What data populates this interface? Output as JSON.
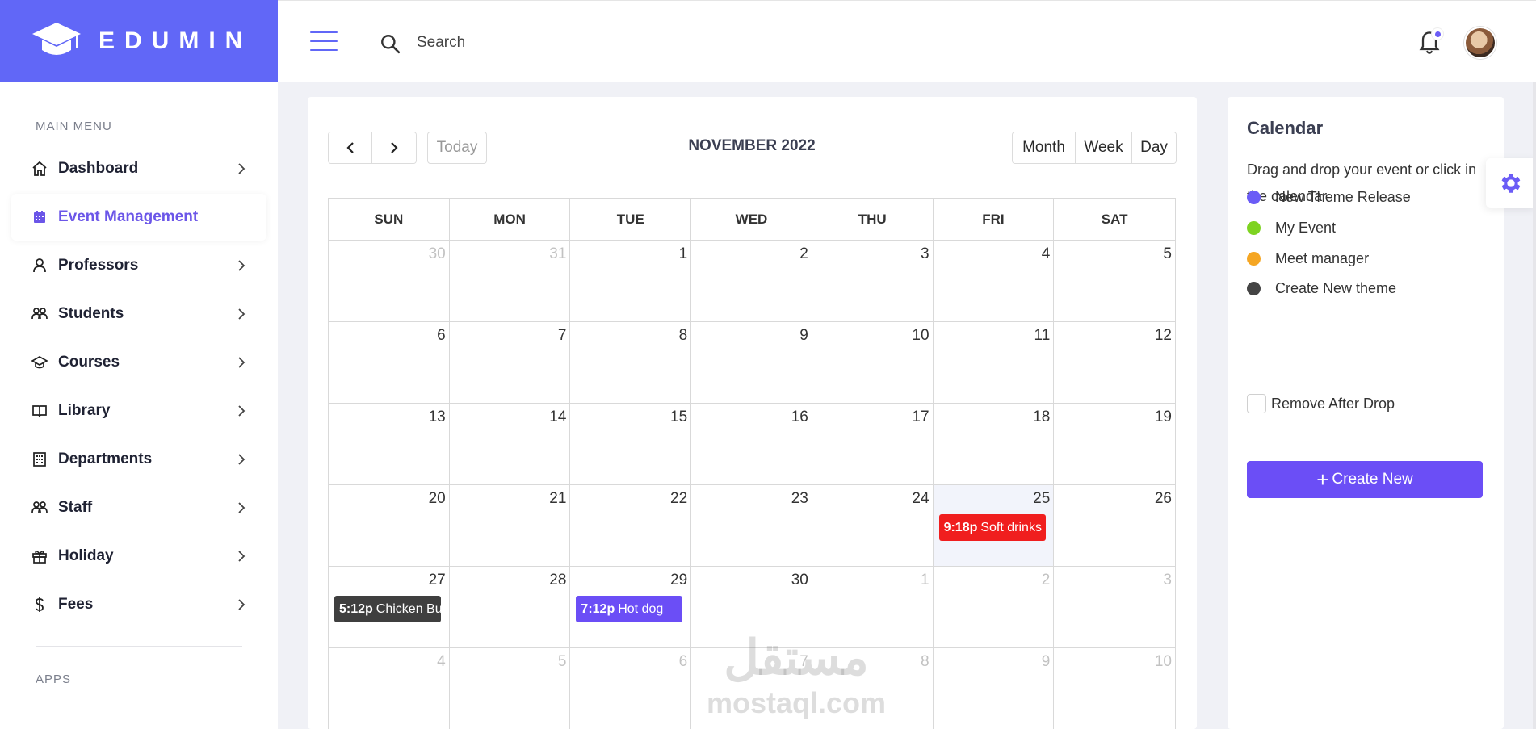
{
  "brand": {
    "name": "EDUMIN",
    "color": "#6167f7"
  },
  "header": {
    "search_placeholder": "Search"
  },
  "sidebar": {
    "section_main": "MAIN MENU",
    "section_apps": "APPS",
    "items": [
      {
        "label": "Dashboard",
        "icon": "home-icon"
      },
      {
        "label": "Event Management",
        "icon": "calendar-icon",
        "active": true
      },
      {
        "label": "Professors",
        "icon": "user-icon"
      },
      {
        "label": "Students",
        "icon": "users-icon"
      },
      {
        "label": "Courses",
        "icon": "graduation-cap-icon"
      },
      {
        "label": "Library",
        "icon": "book-icon"
      },
      {
        "label": "Departments",
        "icon": "building-icon"
      },
      {
        "label": "Staff",
        "icon": "users-icon"
      },
      {
        "label": "Holiday",
        "icon": "gift-icon"
      },
      {
        "label": "Fees",
        "icon": "dollar-icon"
      }
    ]
  },
  "calendar": {
    "title": "NOVEMBER 2022",
    "today_label": "Today",
    "views": [
      "Month",
      "Week",
      "Day"
    ],
    "weekdays": [
      "SUN",
      "MON",
      "TUE",
      "WED",
      "THU",
      "FRI",
      "SAT"
    ],
    "days": [
      {
        "n": "30",
        "other": true
      },
      {
        "n": "31",
        "other": true
      },
      {
        "n": "1"
      },
      {
        "n": "2"
      },
      {
        "n": "3"
      },
      {
        "n": "4"
      },
      {
        "n": "5"
      },
      {
        "n": "6"
      },
      {
        "n": "7"
      },
      {
        "n": "8"
      },
      {
        "n": "9"
      },
      {
        "n": "10"
      },
      {
        "n": "11"
      },
      {
        "n": "12"
      },
      {
        "n": "13"
      },
      {
        "n": "14"
      },
      {
        "n": "15"
      },
      {
        "n": "16"
      },
      {
        "n": "17"
      },
      {
        "n": "18"
      },
      {
        "n": "19"
      },
      {
        "n": "20"
      },
      {
        "n": "21"
      },
      {
        "n": "22"
      },
      {
        "n": "23"
      },
      {
        "n": "24"
      },
      {
        "n": "25",
        "today": true
      },
      {
        "n": "26"
      },
      {
        "n": "27"
      },
      {
        "n": "28"
      },
      {
        "n": "29"
      },
      {
        "n": "30"
      },
      {
        "n": "1",
        "other": true
      },
      {
        "n": "2",
        "other": true
      },
      {
        "n": "3",
        "other": true
      },
      {
        "n": "4",
        "other": true
      },
      {
        "n": "5",
        "other": true
      },
      {
        "n": "6",
        "other": true
      },
      {
        "n": "7",
        "other": true
      },
      {
        "n": "8",
        "other": true
      },
      {
        "n": "9",
        "other": true
      },
      {
        "n": "10",
        "other": true
      }
    ],
    "events": [
      {
        "day_index": 26,
        "time": "9:18p",
        "title": "Soft drinks",
        "color": "#f01e1e"
      },
      {
        "day_index": 28,
        "time": "5:12p",
        "title": "Chicken Burger",
        "color": "#3f3f3f"
      },
      {
        "day_index": 30,
        "time": "7:12p",
        "title": "Hot dog",
        "color": "#6b4ef6"
      }
    ]
  },
  "panel": {
    "title": "Calendar",
    "description": "Drag and drop your event or click in the calendar",
    "legend": [
      {
        "label": "New Theme Release",
        "color": "#6b5cf6"
      },
      {
        "label": "My Event",
        "color": "#7ed321"
      },
      {
        "label": "Meet manager",
        "color": "#f5a623"
      },
      {
        "label": "Create New theme",
        "color": "#444444"
      }
    ],
    "remove_label": "Remove After Drop",
    "create_label": "Create New"
  },
  "watermark": {
    "arabic": "مستقل",
    "text": "mostaql.com"
  }
}
